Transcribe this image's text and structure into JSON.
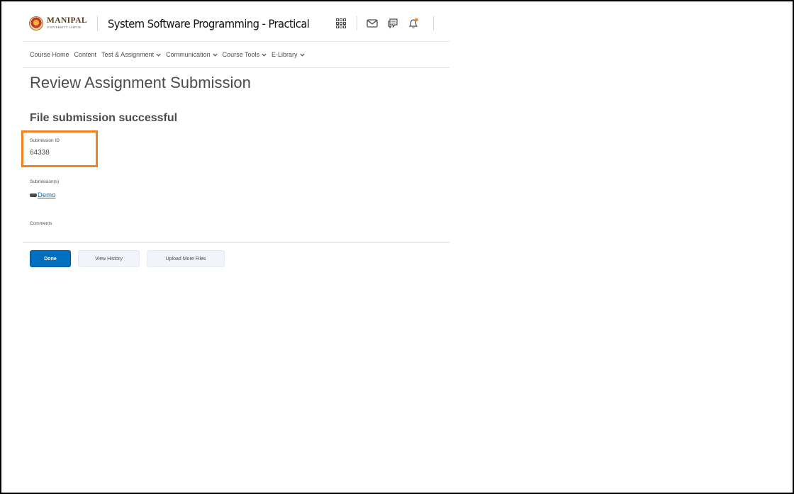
{
  "header": {
    "logo_name": "MANIPAL",
    "logo_subname": "UNIVERSITY JAIPUR",
    "logo_tagline": "",
    "course_title": "System Software Programming - Practical",
    "icons": [
      "apps-grid-icon",
      "mail-icon",
      "chat-icon",
      "bell-icon"
    ],
    "notification_dot_color": "#f5811f"
  },
  "nav": {
    "items": [
      {
        "label": "Course Home",
        "has_dropdown": false
      },
      {
        "label": "Content",
        "has_dropdown": false
      },
      {
        "label": "Test & Assignment",
        "has_dropdown": true
      },
      {
        "label": "Communication",
        "has_dropdown": true
      },
      {
        "label": "Course Tools",
        "has_dropdown": true
      },
      {
        "label": "E-Library",
        "has_dropdown": true
      }
    ]
  },
  "main": {
    "page_title": "Review Assignment Submission",
    "success_message": "File submission successful",
    "submission_id_label": "Submission ID",
    "submission_id_value": "64338",
    "submissions_label": "Submission(s)",
    "submission_file": "Demo",
    "comments_label": "Comments"
  },
  "actions": {
    "done_label": "Done",
    "view_history_label": "View History",
    "upload_more_label": "Upload More Files"
  },
  "colors": {
    "primary": "#006fbf",
    "highlight_border": "#f5811f",
    "text": "#494c4e",
    "link": "#006fbf"
  }
}
